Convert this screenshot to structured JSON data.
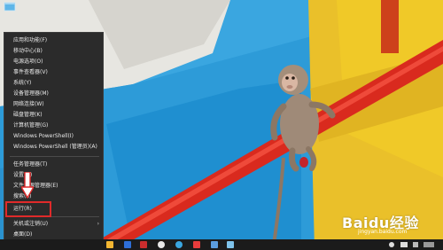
{
  "menu": {
    "items": [
      {
        "label": "应用和功能(F)",
        "group": 1
      },
      {
        "label": "移动中心(B)",
        "group": 1
      },
      {
        "label": "电源选项(O)",
        "group": 1
      },
      {
        "label": "事件查看器(V)",
        "group": 1
      },
      {
        "label": "系统(Y)",
        "group": 1
      },
      {
        "label": "设备管理器(M)",
        "group": 1
      },
      {
        "label": "网络连接(W)",
        "group": 1
      },
      {
        "label": "磁盘管理(K)",
        "group": 1
      },
      {
        "label": "计算机管理(G)",
        "group": 1
      },
      {
        "label": "Windows PowerShell(I)",
        "group": 1
      },
      {
        "label": "Windows PowerShell (管理员)(A)",
        "group": 1
      },
      {
        "label": "任务管理器(T)",
        "group": 2
      },
      {
        "label": "设置(N)",
        "group": 2
      },
      {
        "label": "文件资源管理器(E)",
        "group": 2
      },
      {
        "label": "搜索(S)",
        "group": 2
      },
      {
        "label": "运行(R)",
        "group": 2
      },
      {
        "label": "关机或注销(U)",
        "group": 3
      },
      {
        "label": "桌面(D)",
        "group": 3
      }
    ]
  },
  "highlighted_item": "运行(R)",
  "watermark": {
    "brand": "Baidu经验",
    "url": "jingyan.baidu.com"
  },
  "colors": {
    "menu_bg": "#2b2b2b",
    "highlight": "#e02a2a",
    "taskbar": "#1b1b1b"
  },
  "taskbar": {
    "icons": [
      "edge-icon",
      "store-icon",
      "game-icon",
      "qq-icon",
      "browser-icon",
      "media-icon",
      "mail-icon",
      "app-icon"
    ]
  }
}
